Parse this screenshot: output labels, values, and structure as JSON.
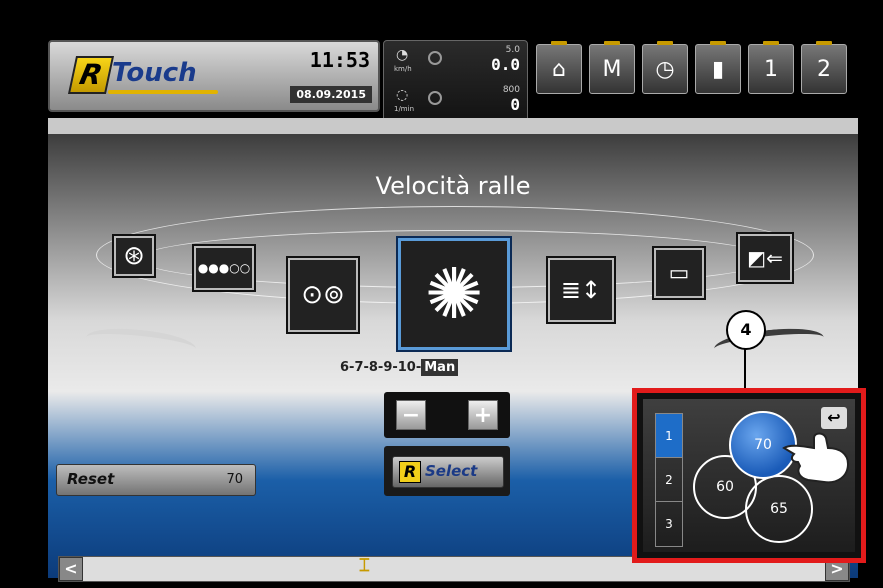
{
  "header": {
    "brand_r": "R",
    "brand_text": "Touch",
    "time": "11:53",
    "date": "08.09.2015"
  },
  "gauges": [
    {
      "name": "speed",
      "unit": "km/h",
      "limit": "5.0",
      "value": "0.0"
    },
    {
      "name": "rpm",
      "unit": "1/min",
      "limit": "800",
      "value": "0"
    }
  ],
  "toolbar": {
    "buttons": [
      {
        "name": "home",
        "glyph": "⌂"
      },
      {
        "name": "menu",
        "glyph": "M"
      },
      {
        "name": "timer",
        "glyph": "◷"
      },
      {
        "name": "stats",
        "glyph": "▮"
      },
      {
        "name": "screen1",
        "glyph": "1"
      },
      {
        "name": "screen2",
        "glyph": "2"
      }
    ]
  },
  "main": {
    "title": "Velocità ralle",
    "sequence_prefix": "6-7-8-9-10-",
    "sequence_mode": "Man",
    "minus": "−",
    "plus": "+",
    "reset_label": "Reset",
    "reset_value": "70",
    "select_r": "R",
    "select_label": "Select"
  },
  "popup": {
    "tabs": [
      "1",
      "2",
      "3"
    ],
    "active_tab": "1",
    "back": "↩",
    "values": [
      "70",
      "60",
      "65"
    ]
  },
  "callout": "4",
  "scrollbar": {
    "left": "<",
    "right": ">",
    "position": 0.38
  },
  "colors": {
    "accent_blue": "#1e6dc8",
    "highlight_red": "#e21b1b",
    "brand_yellow": "#f2cf1a"
  }
}
